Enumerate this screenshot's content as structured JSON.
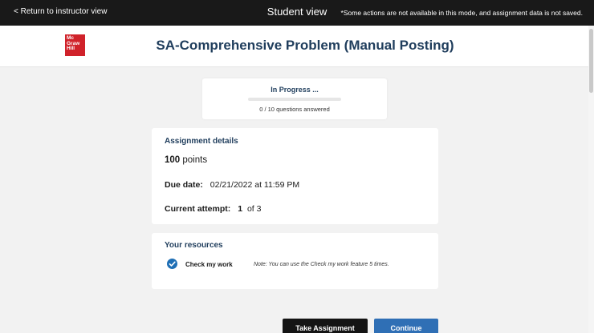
{
  "topbar": {
    "back_label": "< Return to instructor view",
    "mode_title": "Student view",
    "notice": "*Some actions are not available in this mode, and assignment data is not saved."
  },
  "header": {
    "logo_text": "Mc Graw Hill",
    "title": "SA-Comprehensive Problem (Manual Posting)"
  },
  "progress": {
    "status": "In Progress ...",
    "answered_text": "0 / 10 questions answered",
    "fraction": 0.0
  },
  "assignment": {
    "heading": "Assignment details",
    "points_value": "100",
    "points_unit": "points",
    "due_label": "Due date:",
    "due_value": "02/21/2022 at 11:59 PM",
    "attempt_label": "Current attempt:",
    "attempt_current": "1",
    "attempt_rest": "of 3"
  },
  "resources": {
    "heading": "Your resources",
    "check_label": "Check my work",
    "note": "Note: You can use the Check my work feature 5 times."
  },
  "buttons": {
    "primary_label": "Take Assignment",
    "continue_label": "Continue"
  },
  "colors": {
    "accent": "#1f6fb5",
    "heading": "#1f3d5c",
    "brand_red": "#d0222a",
    "topbar": "#191919"
  }
}
